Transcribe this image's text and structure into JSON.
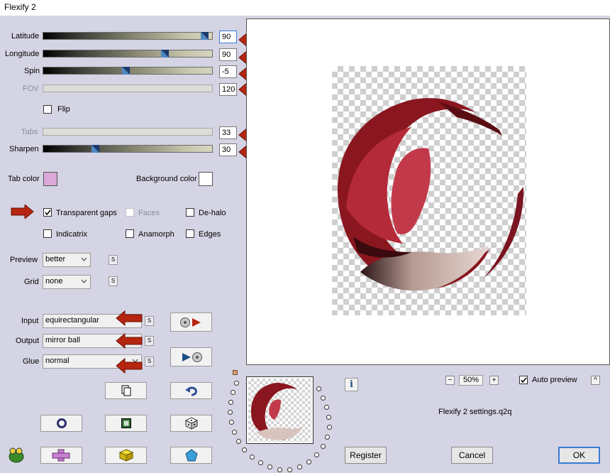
{
  "window": {
    "title": "Flexify 2"
  },
  "sliders": [
    {
      "label": "Latitude",
      "value": "90",
      "position": 0.98,
      "disabled": false,
      "focused": true
    },
    {
      "label": "Longitude",
      "value": "90",
      "position": 0.73,
      "disabled": false,
      "focused": false
    },
    {
      "label": "Spin",
      "value": "-5",
      "position": 0.49,
      "disabled": false,
      "focused": false
    },
    {
      "label": "FOV",
      "value": "120",
      "position": null,
      "disabled": true,
      "focused": false
    },
    {
      "label": "Tabs",
      "value": "33",
      "position": null,
      "disabled": true,
      "focused": false
    },
    {
      "label": "Sharpen",
      "value": "30",
      "position": 0.3,
      "disabled": false,
      "focused": false
    }
  ],
  "checkboxes": {
    "flip": {
      "label": "Flip",
      "checked": false
    },
    "transparent_gaps": {
      "label": "Transparent gaps",
      "checked": true
    },
    "faces": {
      "label": "Faces",
      "checked": false,
      "disabled": true
    },
    "de_halo": {
      "label": "De-halo",
      "checked": false
    },
    "indicatrix": {
      "label": "Indicatrix",
      "checked": false
    },
    "anamorph": {
      "label": "Anamorph",
      "checked": false
    },
    "edges": {
      "label": "Edges",
      "checked": false
    },
    "auto_preview": {
      "label": "Auto preview",
      "checked": true
    }
  },
  "colors": {
    "tab_color_label": "Tab color",
    "tab_color": "#dba8d8",
    "background_color_label": "Background color",
    "background_color": "#ffffff",
    "annotation_arrow": "#b52510"
  },
  "dropdowns": {
    "preview": {
      "label": "Preview",
      "value": "better"
    },
    "grid": {
      "label": "Grid",
      "value": "none"
    },
    "input": {
      "label": "Input",
      "value": "equirectangular"
    },
    "output": {
      "label": "Output",
      "value": "mirror ball"
    },
    "glue": {
      "label": "Glue",
      "value": "normal"
    }
  },
  "small_button_label": "S",
  "zoom": {
    "value": "50%",
    "minus": "−",
    "plus": "+"
  },
  "settings_file": "Flexify 2 settings.q2q",
  "buttons": {
    "register": "Register",
    "cancel": "Cancel",
    "ok": "OK",
    "collapse": "^",
    "info": "i"
  },
  "icons": [
    "copy-icon",
    "undo-icon",
    "circle-icon",
    "square-icon",
    "dice-icon",
    "puzzle-cross-icon",
    "cube-icon",
    "pentagon-icon",
    "frog-logo-icon",
    "input-to-output-icon",
    "output-to-input-icon"
  ]
}
